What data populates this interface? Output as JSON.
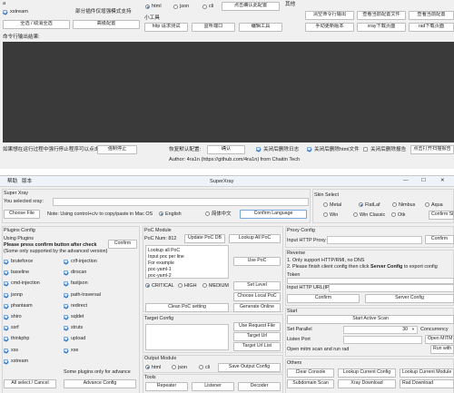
{
  "top": {
    "frame_bg": "#f0f0f0",
    "output_bg": "#3a3a3a",
    "left": {
      "partial_text": "a",
      "xstream_label": "xstream",
      "select_all_button": "全选 / 取消全选",
      "experimental_text": "部分插件仅增强模式支持",
      "advanced_button": "高级配置"
    },
    "poc": {
      "radio_html": "html",
      "radio_json": "json",
      "radio_cli": "cli",
      "confirm_button": "点击确认此配置",
      "tools_title": "小工具",
      "http_test_button": "http 请求测试",
      "listen_port_button": "监听端口",
      "edit_tool_button": "编辑工具"
    },
    "other": {
      "title": "其他",
      "clear_cmd_button": "清空命令行输出",
      "view_config_button": "查看当前配置文件",
      "view_module_button": "查看当前配置",
      "manual_update_button": "手动更新版本",
      "xray_download_button": "xray下载页面",
      "rad_download_button": "rad下载页面"
    },
    "cmd_output_label": "命令行输出结果:",
    "bottom": {
      "stop_hint": "如果想在运行过程中强行停止程序可以点击:",
      "force_stop_button": "强制停止",
      "restore_hint": "恢复默认配置:",
      "confirm_button": "确认",
      "auto_delete_log": "关闭后删除日志",
      "auto_delete_html": "关闭后删除html文件",
      "auto_delete_report": "关闭后删除报告",
      "open_report_button": "点击打开扫描报告"
    },
    "author": "Author: 4ra1n (https://github.com/4ra1n) from Chaitin Tech"
  },
  "window": {
    "menu": [
      "帮助",
      "版本"
    ],
    "title": "SuperXray",
    "minimize_glyph": "—",
    "maximize_glyph": "☐",
    "close_glyph": "✕"
  },
  "super_xray": {
    "title": "Super Xray",
    "selected_label": "You selected xray:",
    "choose_file_button": "Choose File",
    "note": "Note: Using control+c/v to copy/paste in Mac OS",
    "lang_english": "English",
    "lang_chinese": "简体中文",
    "confirm_language_button": "Confirm Language"
  },
  "skin": {
    "title": "Skin Select",
    "options": [
      "Metal",
      "FlatLaf",
      "Nimbus",
      "Aqua",
      "Win",
      "Win Classic",
      "Otk"
    ],
    "confirm_button": "Confirm Skin"
  },
  "plugins": {
    "title": "Plugins Config",
    "using_label": "Using Plugins",
    "press_confirm": "Please press confirm button after check",
    "advanced_note": "(Some only supported by the advanced version)",
    "confirm_button": "Confirm",
    "left_col": [
      "bruteforce",
      "baseline",
      "cmd-injection",
      "jsonp",
      "phantasm",
      "shiro",
      "ssrf",
      "thinkphp",
      "xss",
      "xstream"
    ],
    "right_col": [
      "crlf-injection",
      "dirscan",
      "fastjson",
      "path-traversal",
      "redirect",
      "sqldet",
      "struts",
      "upload",
      "xxe"
    ],
    "advance_only": "Some plugins only for advance",
    "select_all_button": "All select / Cancel",
    "advance_config_button": "Advance Config"
  },
  "poc_module": {
    "title": "PoC Module",
    "poc_num": "PoC Num: 812",
    "update_db_button": "Update PoC DB",
    "lookup_all_button": "Lookup All PoC",
    "textarea_lines": [
      "Lookup all PoC",
      "Input poc per line",
      "For example",
      "poc-yaml-1",
      "poc-yaml-2"
    ],
    "use_poc_button": "Use PoC",
    "level_critical": "CRITICAL",
    "level_high": "HIGH",
    "level_medium": "MEDIUM",
    "set_level_button": "Set Level",
    "choose_local_button": "Choose Local PoC",
    "clean_poc_button": "Clean PoC setting",
    "generate_online_button": "Generate Online"
  },
  "target": {
    "title": "Target Config",
    "use_request_button": "Use Request File",
    "target_url_button": "Target Url",
    "target_list_button": "Target Url List"
  },
  "output": {
    "title": "Output Module",
    "html": "html",
    "json": "json",
    "cli": "cli",
    "save_button": "Save Output Config"
  },
  "tools": {
    "title": "Tools",
    "repeater_button": "Repeater",
    "listener_button": "Listener",
    "decoder_button": "Decoder"
  },
  "proxy": {
    "title": "Proxy Config",
    "input_label": "Input HTTP Proxy",
    "confirm_button": "Confirm"
  },
  "reverse": {
    "title": "Reverse",
    "line1": "1. Only support HTTP/RMI, no DNS",
    "line2_pre": "2. Please finish client config then click ",
    "line2_bold": "Server Config",
    "line2_post": " to export config",
    "token_label": "Token",
    "url_label": "Input HTTP URL(IP)",
    "confirm_button": "Confirm",
    "server_config_button": "Server Config"
  },
  "start": {
    "title": "Start",
    "active_scan_button": "Start Active Scan",
    "parallel_label": "Set Parallel",
    "parallel_value": "30",
    "concurrency_label": "Concurrency",
    "listen_port_label": "Listen Port",
    "open_mitm_button": "Open MITM",
    "mitm_crawl_label": "Open mitm scan and run rad",
    "run_button": "Run with"
  },
  "others": {
    "title": "Others",
    "clear_console_button": "Clear Console",
    "lookup_config_button": "Lookup Current Config",
    "lookup_module_button": "Lookup Current Module",
    "subdomain_button": "Subdomain Scan",
    "xray_download_button": "Xray Download",
    "rad_download_button": "Rad Download"
  }
}
